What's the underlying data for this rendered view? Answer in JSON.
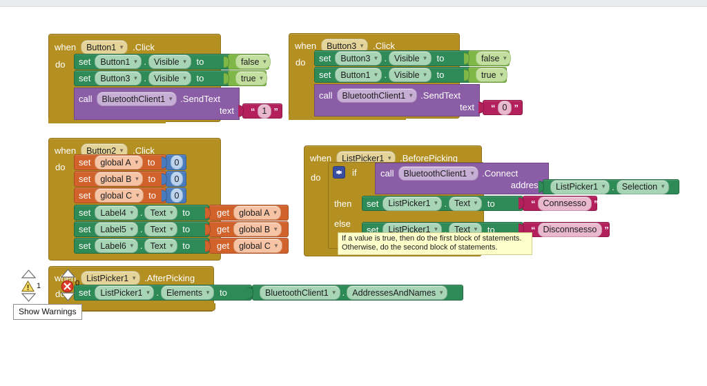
{
  "editor": {
    "name": "MIT App Inventor Blocks Editor",
    "background": "#ffffff"
  },
  "palette": {
    "event_block": "#B49023",
    "setter_block": "#2E8B57",
    "call_block": "#8A5DA6",
    "variable_block": "#D2622C",
    "math_block": "#4A7CBD",
    "text_block": "#B3205C",
    "logic_block": "#7FB847",
    "tooltip_bg": "#FFFFCC"
  },
  "blocks": {
    "button1_click": {
      "when": "when",
      "component": "Button1",
      "event": ".Click",
      "do": "do",
      "rows": [
        {
          "set": "set",
          "component": "Button1",
          "dot": ".",
          "property": "Visible",
          "to": "to",
          "value": "false"
        },
        {
          "set": "set",
          "component": "Button3",
          "dot": ".",
          "property": "Visible",
          "to": "to",
          "value": "true"
        }
      ],
      "call": {
        "call": "call",
        "component": "BluetoothClient1",
        "method": ".SendText",
        "arg_label": "text",
        "arg_value": "1"
      }
    },
    "button3_click": {
      "when": "when",
      "component": "Button3",
      "event": ".Click",
      "do": "do",
      "rows": [
        {
          "set": "set",
          "component": "Button3",
          "dot": ".",
          "property": "Visible",
          "to": "to",
          "value": "false"
        },
        {
          "set": "set",
          "component": "Button1",
          "dot": ".",
          "property": "Visible",
          "to": "to",
          "value": "true"
        }
      ],
      "call": {
        "call": "call",
        "component": "BluetoothClient1",
        "method": ".SendText",
        "arg_label": "text",
        "arg_value": "0"
      }
    },
    "button2_click": {
      "when": "when",
      "component": "Button2",
      "event": ".Click",
      "do": "do",
      "var_rows": [
        {
          "set": "set",
          "variable": "global A",
          "to": "to",
          "value": "0"
        },
        {
          "set": "set",
          "variable": "global B",
          "to": "to",
          "value": "0"
        },
        {
          "set": "set",
          "variable": "global C",
          "to": "to",
          "value": "0"
        }
      ],
      "label_rows": [
        {
          "set": "set",
          "component": "Label4",
          "dot": ".",
          "property": "Text",
          "to": "to",
          "get": "get",
          "variable": "global A"
        },
        {
          "set": "set",
          "component": "Label5",
          "dot": ".",
          "property": "Text",
          "to": "to",
          "get": "get",
          "variable": "global B"
        },
        {
          "set": "set",
          "component": "Label6",
          "dot": ".",
          "property": "Text",
          "to": "to",
          "get": "get",
          "variable": "global C"
        }
      ]
    },
    "listpicker_beforepicking": {
      "when": "when",
      "component": "ListPicker1",
      "event": ".BeforePicking",
      "do": "do",
      "if": "if",
      "then": "then",
      "else": "else",
      "condition": {
        "call": "call",
        "component": "BluetoothClient1",
        "method": ".Connect",
        "arg_label": "address",
        "arg_component": "ListPicker1",
        "dot": ".",
        "arg_property": "Selection"
      },
      "then_row": {
        "set": "set",
        "component": "ListPicker1",
        "dot": ".",
        "property": "Text",
        "to": "to",
        "value": "Connsesso"
      },
      "else_row": {
        "set": "set",
        "component": "ListPicker1",
        "dot": ".",
        "property": "Text",
        "to": "to",
        "value": "Disconnsesso"
      },
      "tooltip": "If a value is true, then do the first block of statements.\nOtherwise, do the second block of statements."
    },
    "listpicker_afterpicking": {
      "when": "when",
      "component": "ListPicker1",
      "event": ".AfterPicking",
      "do": "do",
      "row": {
        "set": "set",
        "component": "ListPicker1",
        "dot": ".",
        "property": "Elements",
        "to": "to",
        "value_component": "BluetoothClient1",
        "value_dot": ".",
        "value_property": "AddressesAndNames"
      }
    }
  },
  "warnings": {
    "warning_count": "1",
    "error_count": "0",
    "show_warnings_label": "Show Warnings"
  }
}
